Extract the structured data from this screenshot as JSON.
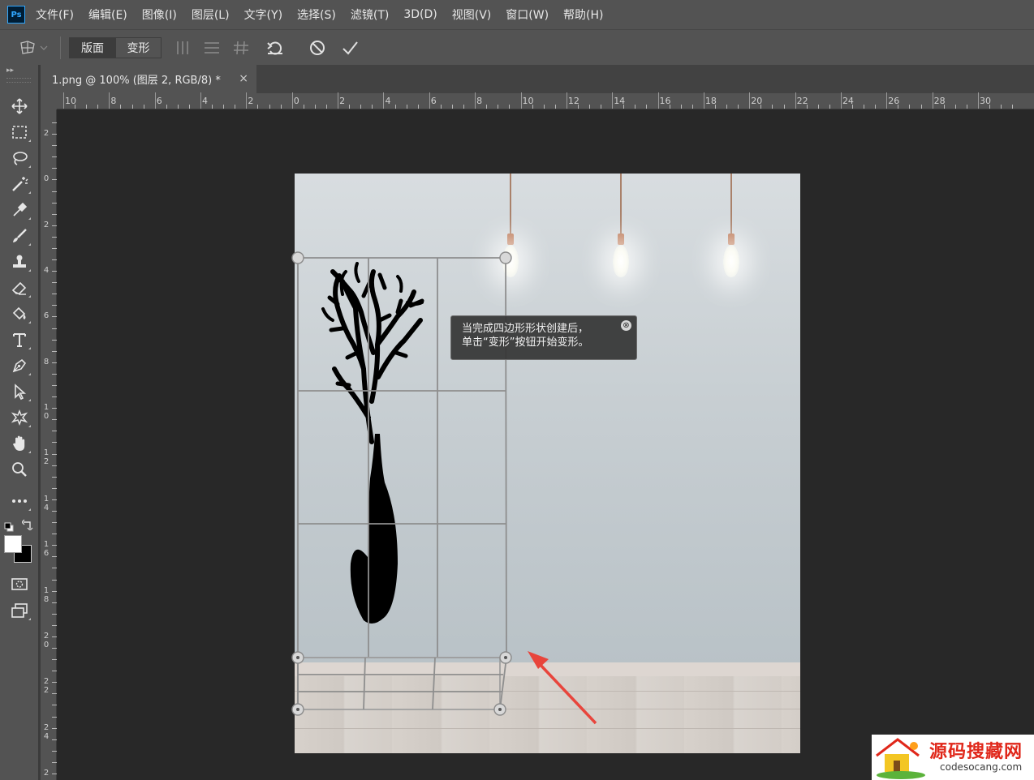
{
  "app": {
    "logo_text": "Ps"
  },
  "menu": [
    "文件(F)",
    "编辑(E)",
    "图像(I)",
    "图层(L)",
    "文字(Y)",
    "选择(S)",
    "滤镜(T)",
    "3D(D)",
    "视图(V)",
    "窗口(W)",
    "帮助(H)"
  ],
  "options_bar": {
    "mode_segments": [
      {
        "label": "版面",
        "active": true
      },
      {
        "label": "变形",
        "active": false
      }
    ],
    "icons": [
      "vertical-lines-icon",
      "horizontal-lines-icon",
      "grid-icon",
      "undo-rotate-icon",
      "cancel-icon",
      "commit-check-icon"
    ]
  },
  "document_tab": {
    "title": "1.png @ 100% (图层 2, RGB/8) *",
    "close_glyph": "×"
  },
  "rulers": {
    "horizontal_labels": [
      "10",
      "8",
      "6",
      "4",
      "2",
      "0",
      "2",
      "4",
      "6",
      "8",
      "10",
      "12",
      "14",
      "16",
      "18",
      "20",
      "22",
      "24",
      "26",
      "28",
      "30"
    ],
    "vertical_labels": [
      "2",
      "0",
      "2",
      "4",
      "6",
      "8",
      "1\n0",
      "1\n2",
      "1\n4",
      "1\n6",
      "1\n8",
      "2\n0",
      "2\n2",
      "2\n4",
      "2"
    ]
  },
  "tooltip": {
    "line1": "当完成四边形形状创建后，",
    "line2": "单击“变形”按钮开始变形。",
    "close_glyph": "⊗"
  },
  "toolbox": [
    "move-icon",
    "marquee-icon",
    "lasso-icon",
    "magic-wand-icon",
    "eyedropper-icon",
    "brush-icon",
    "stamp-icon",
    "eraser-icon",
    "paint-bucket-icon",
    "type-icon",
    "pen-icon",
    "path-selection-icon",
    "custom-shape-icon",
    "hand-icon",
    "zoom-icon",
    "more-tools-icon"
  ],
  "colors": {
    "foreground": "#ffffff",
    "background": "#000000",
    "accent": "#31a8ff",
    "arrow": "#e8453c"
  },
  "watermark": {
    "title": "源码搜藏网",
    "url": "codesocang.com"
  }
}
